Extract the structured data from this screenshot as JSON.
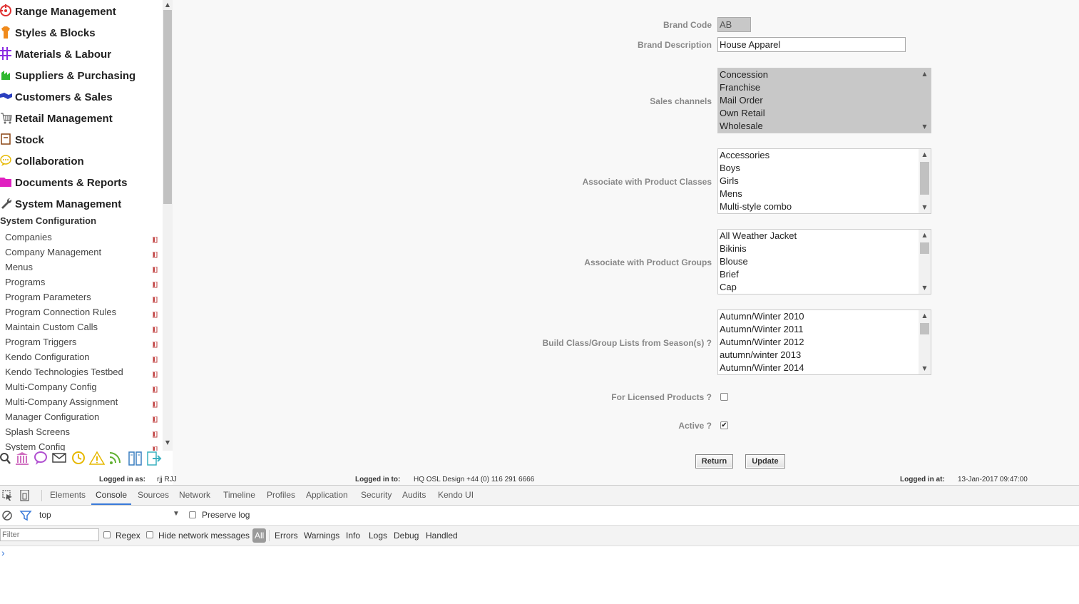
{
  "sidebar": {
    "main_menu": [
      {
        "label": "Range Management",
        "icon": "target-icon",
        "color": "#e03030"
      },
      {
        "label": "Styles & Blocks",
        "icon": "shirt-icon",
        "color": "#f08a1c"
      },
      {
        "label": "Materials & Labour",
        "icon": "grid-icon",
        "color": "#8b2be2"
      },
      {
        "label": "Suppliers & Purchasing",
        "icon": "factory-icon",
        "color": "#2eb82e"
      },
      {
        "label": "Customers & Sales",
        "icon": "handshake-icon",
        "color": "#2a3fbf"
      },
      {
        "label": "Retail Management",
        "icon": "cart-icon",
        "color": "#666666"
      },
      {
        "label": "Stock",
        "icon": "box-icon",
        "color": "#8b4513"
      },
      {
        "label": "Collaboration",
        "icon": "chat-bubble-icon",
        "color": "#e6b800"
      },
      {
        "label": "Documents & Reports",
        "icon": "folder-icon",
        "color": "#e020c0"
      },
      {
        "label": "System Management",
        "icon": "wrench-icon",
        "color": "#555555"
      }
    ],
    "section_title": "System Configuration",
    "sub_items": [
      "Companies",
      "Company Management",
      "Menus",
      "Programs",
      "Program Parameters",
      "Program Connection Rules",
      "Maintain Custom Calls",
      "Program Triggers",
      "Kendo Configuration",
      "Kendo Technologies Testbed",
      "Multi-Company Config",
      "Multi-Company Assignment",
      "Manager Configuration",
      "Splash Screens",
      "System Config"
    ]
  },
  "toolbar_icons": [
    "search-icon",
    "bank-icon",
    "chat-icon",
    "mail-icon",
    "clock-icon",
    "warning-icon",
    "rss-icon",
    "columns-icon",
    "exit-icon"
  ],
  "form": {
    "brand_code_label": "Brand Code",
    "brand_code_value": "AB",
    "brand_desc_label": "Brand Description",
    "brand_desc_value": "House Apparel",
    "sales_channels_label": "Sales channels",
    "sales_channels": [
      "Concession",
      "Franchise",
      "Mail Order",
      "Own Retail",
      "Wholesale"
    ],
    "product_classes_label": "Associate with Product Classes",
    "product_classes": [
      "Accessories",
      "Boys",
      "Girls",
      "Mens",
      "Multi-style combo"
    ],
    "product_groups_label": "Associate with Product Groups",
    "product_groups": [
      "All Weather Jacket",
      "Bikinis",
      "Blouse",
      "Brief",
      "Cap"
    ],
    "seasons_label": "Build Class/Group Lists from Season(s) ?",
    "seasons": [
      "Autumn/Winter 2010",
      "Autumn/Winter 2011",
      "Autumn/Winter 2012",
      "autumn/winter 2013",
      "Autumn/Winter 2014"
    ],
    "licensed_label": "For Licensed Products ?",
    "licensed_checked": false,
    "active_label": "Active ?",
    "active_checked": true,
    "return_label": "Return",
    "update_label": "Update"
  },
  "status": {
    "logged_as_key": "Logged in as:",
    "logged_as_val": "rjj  RJJ",
    "logged_to_key": "Logged in to:",
    "logged_to_val": "HQ OSL Design +44 (0) 116 291 6666",
    "logged_at_key": "Logged in at:",
    "logged_at_val": "13-Jan-2017  09:47:00"
  },
  "devtools": {
    "tabs": [
      "Elements",
      "Console",
      "Sources",
      "Network",
      "Timeline",
      "Profiles",
      "Application",
      "Security",
      "Audits",
      "Kendo UI"
    ],
    "active_tab": "Console",
    "context": "top",
    "preserve_log": "Preserve log",
    "filter_placeholder": "Filter",
    "regex": "Regex",
    "hide_network": "Hide network messages",
    "levels": [
      "All",
      "Errors",
      "Warnings",
      "Info",
      "Logs",
      "Debug",
      "Handled"
    ],
    "prompt": "›"
  }
}
